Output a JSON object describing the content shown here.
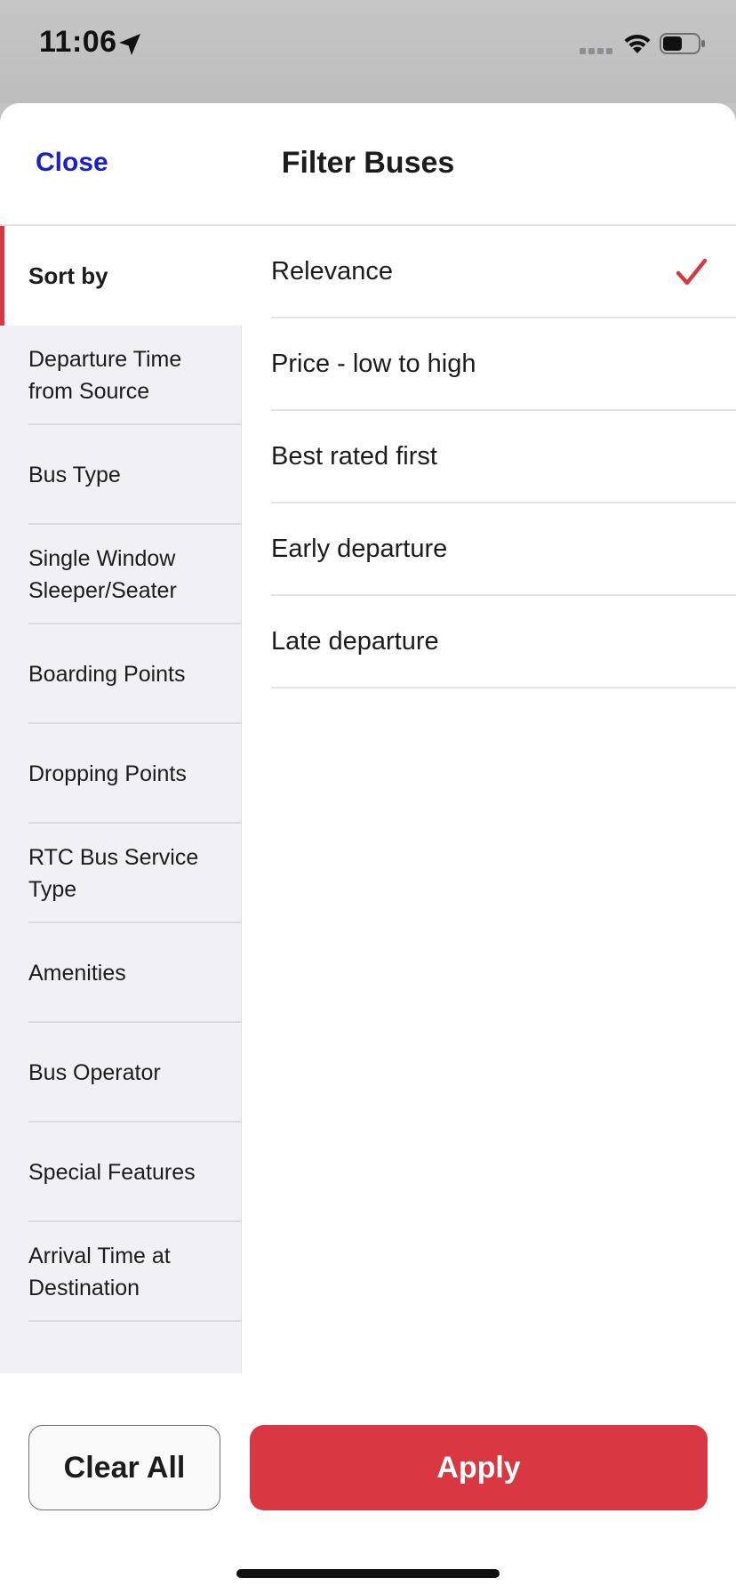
{
  "status_bar": {
    "time": "11:06",
    "icons": [
      "location-arrow-icon",
      "signal-icon",
      "wifi-icon",
      "battery-icon"
    ]
  },
  "header": {
    "close_label": "Close",
    "title": "Filter Buses"
  },
  "sidebar": {
    "items": [
      {
        "label": "Sort by",
        "active": true
      },
      {
        "label": "Departure Time from Source",
        "active": false
      },
      {
        "label": "Bus Type",
        "active": false
      },
      {
        "label": "Single Window Sleeper/Seater",
        "active": false
      },
      {
        "label": "Boarding Points",
        "active": false
      },
      {
        "label": "Dropping Points",
        "active": false
      },
      {
        "label": "RTC Bus Service Type",
        "active": false
      },
      {
        "label": "Amenities",
        "active": false
      },
      {
        "label": "Bus Operator",
        "active": false
      },
      {
        "label": "Special Features",
        "active": false
      },
      {
        "label": "Arrival Time at Destination",
        "active": false
      }
    ]
  },
  "sort_options": [
    {
      "label": "Relevance",
      "selected": true
    },
    {
      "label": "Price - low to high",
      "selected": false
    },
    {
      "label": "Best rated first",
      "selected": false
    },
    {
      "label": "Early departure",
      "selected": false
    },
    {
      "label": "Late departure",
      "selected": false
    }
  ],
  "footer": {
    "clear_label": "Clear All",
    "apply_label": "Apply"
  },
  "colors": {
    "accent_red": "#d93843",
    "link_blue": "#1a1fc7",
    "sidebar_bg": "#f1f0f6"
  }
}
